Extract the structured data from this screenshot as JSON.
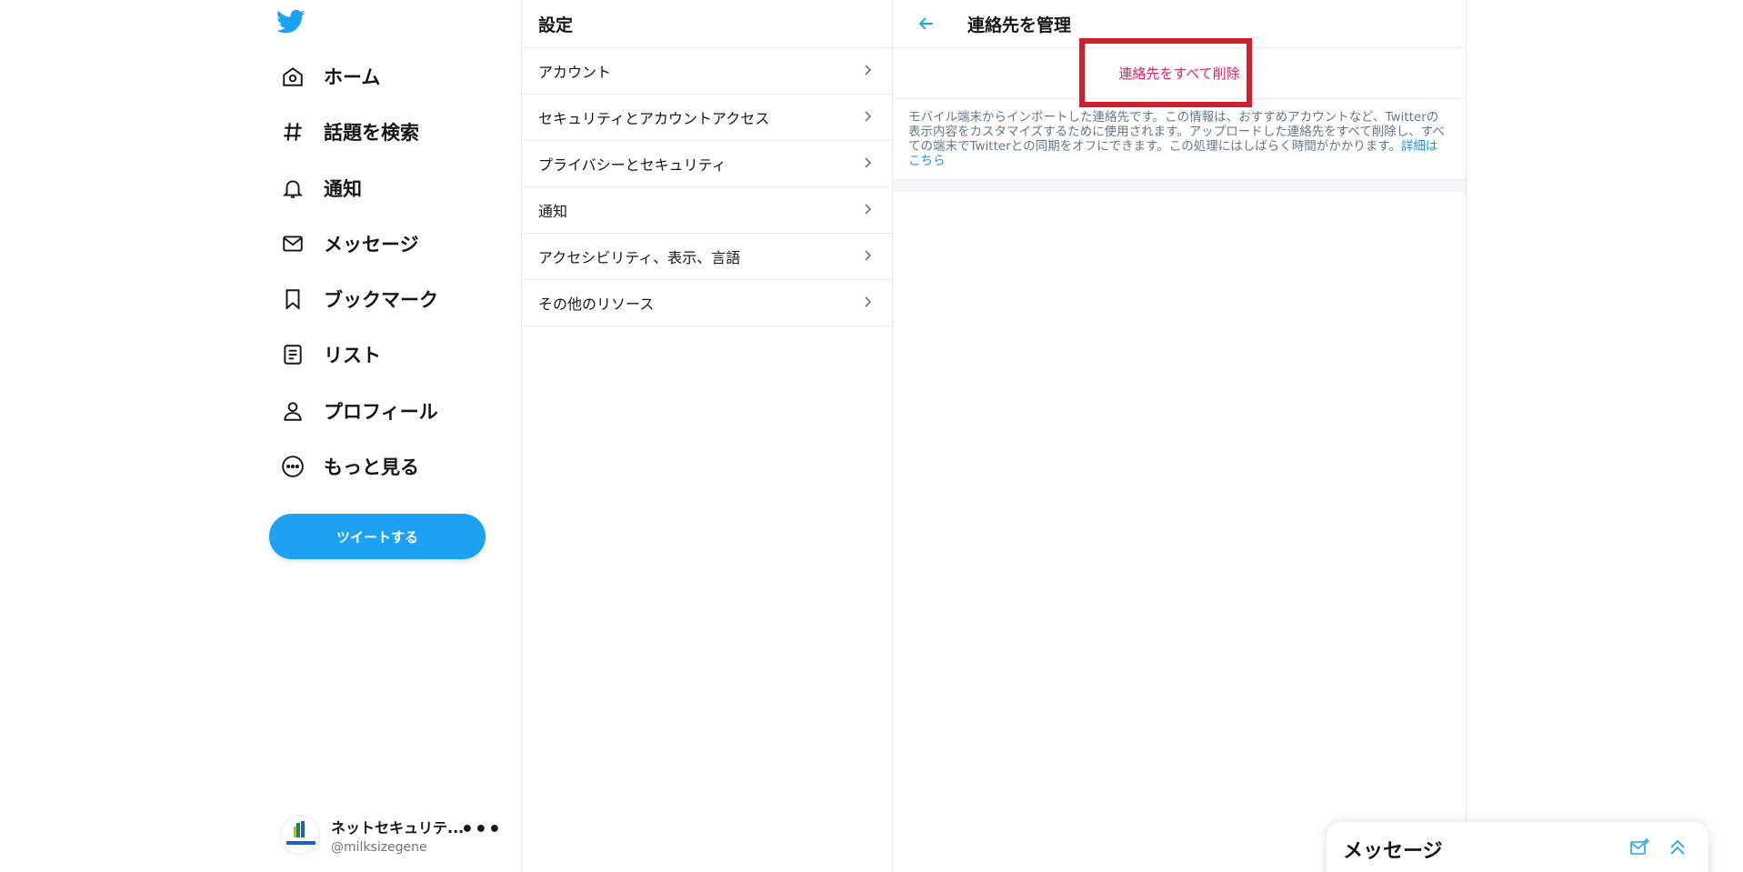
{
  "nav": {
    "items": [
      {
        "label": "ホーム",
        "icon": "home-icon"
      },
      {
        "label": "話題を検索",
        "icon": "hashtag-icon"
      },
      {
        "label": "通知",
        "icon": "bell-icon"
      },
      {
        "label": "メッセージ",
        "icon": "envelope-icon"
      },
      {
        "label": "ブックマーク",
        "icon": "bookmark-icon"
      },
      {
        "label": "リスト",
        "icon": "list-icon"
      },
      {
        "label": "プロフィール",
        "icon": "person-icon"
      },
      {
        "label": "もっと見る",
        "icon": "more-circle-icon"
      }
    ],
    "tweet_button": "ツイートする",
    "account": {
      "name": "ネットセキュリテ...",
      "handle": "@milksizegene",
      "more": "•••"
    }
  },
  "settings": {
    "title": "設定",
    "items": [
      {
        "label": "アカウント"
      },
      {
        "label": "セキュリティとアカウントアクセス"
      },
      {
        "label": "プライバシーとセキュリティ"
      },
      {
        "label": "通知"
      },
      {
        "label": "アクセシビリティ、表示、言語"
      },
      {
        "label": "その他のリソース"
      }
    ]
  },
  "detail": {
    "title": "連絡先を管理",
    "delete_label": "連絡先をすべて削除",
    "description": "モバイル端末からインポートした連絡先です。この情報は、おすすめアカウントなど、Twitterの表示内容をカスタマイズするために使用されます。アップロードした連絡先をすべて削除し、すべての端末でTwitterとの同期をオフにできます。この処理にはしばらく時間がかかります。",
    "learn_more": "詳細はこちら"
  },
  "messages_drawer": {
    "title": "メッセージ"
  },
  "colors": {
    "accent": "#1da1f2",
    "danger": "#e0245e",
    "highlight": "#d0202c"
  }
}
